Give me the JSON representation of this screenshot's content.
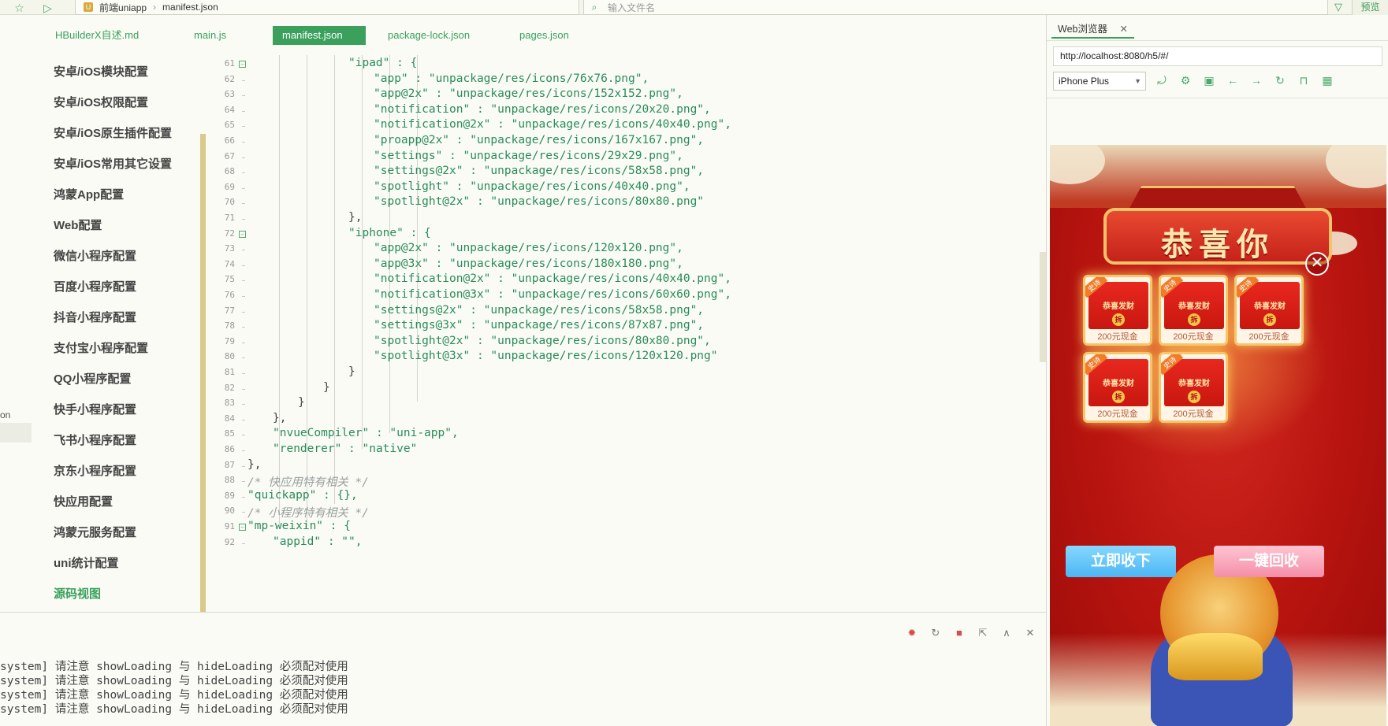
{
  "topbar": {
    "breadcrumb_project": "前端uniapp",
    "breadcrumb_file": "manifest.json",
    "search_placeholder": "输入文件名",
    "preview_label": "预览"
  },
  "tabs": [
    "HBuilderX自述.md",
    "main.js",
    "manifest.json",
    "package-lock.json",
    "pages.json"
  ],
  "nav": {
    "items": [
      "安卓/iOS模块配置",
      "安卓/iOS权限配置",
      "安卓/iOS原生插件配置",
      "安卓/iOS常用其它设置",
      "鸿蒙App配置",
      "Web配置",
      "微信小程序配置",
      "百度小程序配置",
      "抖音小程序配置",
      "支付宝小程序配置",
      "QQ小程序配置",
      "快手小程序配置",
      "飞书小程序配置",
      "京东小程序配置",
      "快应用配置",
      "鸿蒙元服务配置",
      "uni统计配置",
      "源码视图"
    ]
  },
  "code": {
    "line_numbers": [
      "61",
      "62",
      "63",
      "64",
      "65",
      "66",
      "67",
      "68",
      "69",
      "70",
      "71",
      "72",
      "73",
      "74",
      "75",
      "76",
      "77",
      "78",
      "79",
      "80",
      "81",
      "82",
      "83",
      "84",
      "85",
      "86",
      "87",
      "88",
      "89",
      "90",
      "91",
      "92"
    ],
    "lines": [
      "\"ipad\" : {",
      "\"app\" : \"unpackage/res/icons/76x76.png\",",
      "\"app@2x\" : \"unpackage/res/icons/152x152.png\",",
      "\"notification\" : \"unpackage/res/icons/20x20.png\",",
      "\"notification@2x\" : \"unpackage/res/icons/40x40.png\",",
      "\"proapp@2x\" : \"unpackage/res/icons/167x167.png\",",
      "\"settings\" : \"unpackage/res/icons/29x29.png\",",
      "\"settings@2x\" : \"unpackage/res/icons/58x58.png\",",
      "\"spotlight\" : \"unpackage/res/icons/40x40.png\",",
      "\"spotlight@2x\" : \"unpackage/res/icons/80x80.png\"",
      "},",
      "\"iphone\" : {",
      "\"app@2x\" : \"unpackage/res/icons/120x120.png\",",
      "\"app@3x\" : \"unpackage/res/icons/180x180.png\",",
      "\"notification@2x\" : \"unpackage/res/icons/40x40.png\",",
      "\"notification@3x\" : \"unpackage/res/icons/60x60.png\",",
      "\"settings@2x\" : \"unpackage/res/icons/58x58.png\",",
      "\"settings@3x\" : \"unpackage/res/icons/87x87.png\",",
      "\"spotlight@2x\" : \"unpackage/res/icons/80x80.png\",",
      "\"spotlight@3x\" : \"unpackage/res/icons/120x120.png\"",
      "}",
      "}",
      "}",
      "},",
      "\"nvueCompiler\" : \"uni-app\",",
      "\"renderer\" : \"native\"",
      "},",
      "/* 快应用特有相关 */",
      "\"quickapp\" : {},",
      "/* 小程序特有相关 */",
      "\"mp-weixin\" : {",
      "\"appid\" : \"\","
    ]
  },
  "console": {
    "lines": [
      "system] 请注意 showLoading 与 hideLoading 必须配对使用",
      "system] 请注意 showLoading 与 hideLoading 必须配对使用",
      "system] 请注意 showLoading 与 hideLoading 必须配对使用",
      "system] 请注意 showLoading 与 hideLoading 必须配对使用"
    ],
    "side_fragment": "on"
  },
  "browser": {
    "tab_label": "Web浏览器",
    "url": "http://localhost:8080/h5/#/",
    "device": "iPhone Plus"
  },
  "app": {
    "banner_title": "恭喜你",
    "card_tag": "史诗",
    "card_title": "恭喜发财",
    "card_coin": "拆",
    "card_amount": "200元现金",
    "accept_button": "立即收下",
    "recycle_button": "一键回收"
  },
  "colors": {
    "accent": "#3aa05c",
    "keyword": "#2a8c5a",
    "banner_red": "#c5221a"
  }
}
